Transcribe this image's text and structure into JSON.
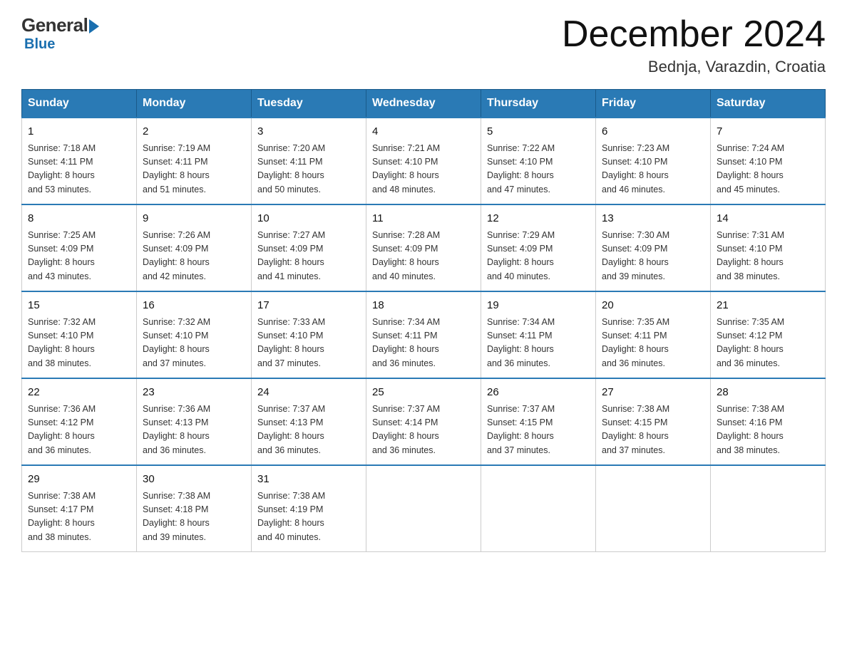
{
  "header": {
    "logo": {
      "general": "General",
      "blue": "Blue"
    },
    "title": "December 2024",
    "location": "Bednja, Varazdin, Croatia"
  },
  "days_of_week": [
    "Sunday",
    "Monday",
    "Tuesday",
    "Wednesday",
    "Thursday",
    "Friday",
    "Saturday"
  ],
  "weeks": [
    [
      {
        "day": "1",
        "sunrise": "7:18 AM",
        "sunset": "4:11 PM",
        "daylight": "8 hours and 53 minutes."
      },
      {
        "day": "2",
        "sunrise": "7:19 AM",
        "sunset": "4:11 PM",
        "daylight": "8 hours and 51 minutes."
      },
      {
        "day": "3",
        "sunrise": "7:20 AM",
        "sunset": "4:11 PM",
        "daylight": "8 hours and 50 minutes."
      },
      {
        "day": "4",
        "sunrise": "7:21 AM",
        "sunset": "4:10 PM",
        "daylight": "8 hours and 48 minutes."
      },
      {
        "day": "5",
        "sunrise": "7:22 AM",
        "sunset": "4:10 PM",
        "daylight": "8 hours and 47 minutes."
      },
      {
        "day": "6",
        "sunrise": "7:23 AM",
        "sunset": "4:10 PM",
        "daylight": "8 hours and 46 minutes."
      },
      {
        "day": "7",
        "sunrise": "7:24 AM",
        "sunset": "4:10 PM",
        "daylight": "8 hours and 45 minutes."
      }
    ],
    [
      {
        "day": "8",
        "sunrise": "7:25 AM",
        "sunset": "4:09 PM",
        "daylight": "8 hours and 43 minutes."
      },
      {
        "day": "9",
        "sunrise": "7:26 AM",
        "sunset": "4:09 PM",
        "daylight": "8 hours and 42 minutes."
      },
      {
        "day": "10",
        "sunrise": "7:27 AM",
        "sunset": "4:09 PM",
        "daylight": "8 hours and 41 minutes."
      },
      {
        "day": "11",
        "sunrise": "7:28 AM",
        "sunset": "4:09 PM",
        "daylight": "8 hours and 40 minutes."
      },
      {
        "day": "12",
        "sunrise": "7:29 AM",
        "sunset": "4:09 PM",
        "daylight": "8 hours and 40 minutes."
      },
      {
        "day": "13",
        "sunrise": "7:30 AM",
        "sunset": "4:09 PM",
        "daylight": "8 hours and 39 minutes."
      },
      {
        "day": "14",
        "sunrise": "7:31 AM",
        "sunset": "4:10 PM",
        "daylight": "8 hours and 38 minutes."
      }
    ],
    [
      {
        "day": "15",
        "sunrise": "7:32 AM",
        "sunset": "4:10 PM",
        "daylight": "8 hours and 38 minutes."
      },
      {
        "day": "16",
        "sunrise": "7:32 AM",
        "sunset": "4:10 PM",
        "daylight": "8 hours and 37 minutes."
      },
      {
        "day": "17",
        "sunrise": "7:33 AM",
        "sunset": "4:10 PM",
        "daylight": "8 hours and 37 minutes."
      },
      {
        "day": "18",
        "sunrise": "7:34 AM",
        "sunset": "4:11 PM",
        "daylight": "8 hours and 36 minutes."
      },
      {
        "day": "19",
        "sunrise": "7:34 AM",
        "sunset": "4:11 PM",
        "daylight": "8 hours and 36 minutes."
      },
      {
        "day": "20",
        "sunrise": "7:35 AM",
        "sunset": "4:11 PM",
        "daylight": "8 hours and 36 minutes."
      },
      {
        "day": "21",
        "sunrise": "7:35 AM",
        "sunset": "4:12 PM",
        "daylight": "8 hours and 36 minutes."
      }
    ],
    [
      {
        "day": "22",
        "sunrise": "7:36 AM",
        "sunset": "4:12 PM",
        "daylight": "8 hours and 36 minutes."
      },
      {
        "day": "23",
        "sunrise": "7:36 AM",
        "sunset": "4:13 PM",
        "daylight": "8 hours and 36 minutes."
      },
      {
        "day": "24",
        "sunrise": "7:37 AM",
        "sunset": "4:13 PM",
        "daylight": "8 hours and 36 minutes."
      },
      {
        "day": "25",
        "sunrise": "7:37 AM",
        "sunset": "4:14 PM",
        "daylight": "8 hours and 36 minutes."
      },
      {
        "day": "26",
        "sunrise": "7:37 AM",
        "sunset": "4:15 PM",
        "daylight": "8 hours and 37 minutes."
      },
      {
        "day": "27",
        "sunrise": "7:38 AM",
        "sunset": "4:15 PM",
        "daylight": "8 hours and 37 minutes."
      },
      {
        "day": "28",
        "sunrise": "7:38 AM",
        "sunset": "4:16 PM",
        "daylight": "8 hours and 38 minutes."
      }
    ],
    [
      {
        "day": "29",
        "sunrise": "7:38 AM",
        "sunset": "4:17 PM",
        "daylight": "8 hours and 38 minutes."
      },
      {
        "day": "30",
        "sunrise": "7:38 AM",
        "sunset": "4:18 PM",
        "daylight": "8 hours and 39 minutes."
      },
      {
        "day": "31",
        "sunrise": "7:38 AM",
        "sunset": "4:19 PM",
        "daylight": "8 hours and 40 minutes."
      },
      null,
      null,
      null,
      null
    ]
  ],
  "labels": {
    "sunrise": "Sunrise:",
    "sunset": "Sunset:",
    "daylight": "Daylight:"
  }
}
